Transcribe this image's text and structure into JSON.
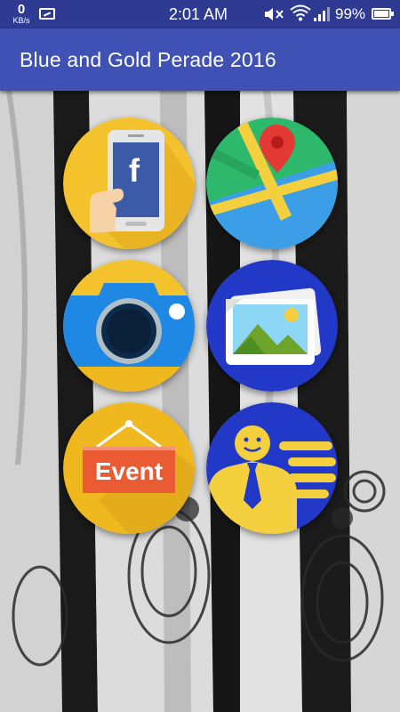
{
  "status_bar": {
    "net_speed": "0",
    "net_unit": "KB/s",
    "time": "2:01 AM",
    "battery": "99%",
    "icons": [
      "usb-icon",
      "mute-icon",
      "wifi-icon",
      "signal-icon",
      "battery-icon"
    ]
  },
  "app_bar": {
    "title": "Blue and Gold Perade 2016",
    "color": "#3f51b5"
  },
  "tiles": [
    {
      "name": "facebook",
      "icon": "facebook-phone-icon",
      "bg": "#f3c22d"
    },
    {
      "name": "map",
      "icon": "map-pin-icon",
      "bg": "#2db86b"
    },
    {
      "name": "camera",
      "icon": "camera-icon",
      "bg": "#1f88e5"
    },
    {
      "name": "gallery",
      "icon": "gallery-icon",
      "bg": "#2238c7"
    },
    {
      "name": "event",
      "icon": "event-sign-icon",
      "bg": "#f0b81f",
      "label": "Event"
    },
    {
      "name": "contact",
      "icon": "contact-card-icon",
      "bg": "#2238c7"
    }
  ],
  "background": {
    "description_icon": "flags-background-icon"
  }
}
